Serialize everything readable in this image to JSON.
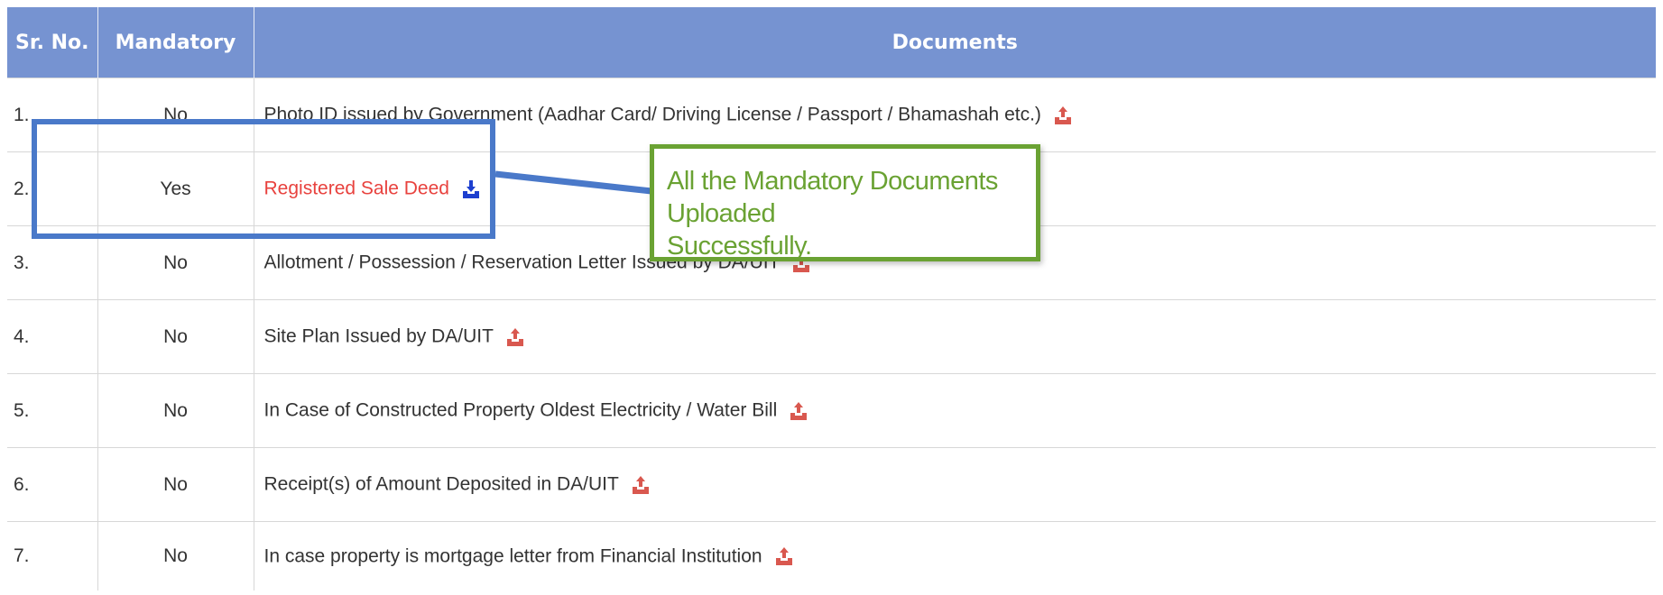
{
  "table": {
    "headers": {
      "sr_no": "Sr. No.",
      "mandatory": "Mandatory",
      "documents": "Documents"
    },
    "rows": [
      {
        "sr": "1.",
        "mandatory": "No",
        "document": "Photo ID issued by Government (Aadhar Card/ Driving License / Passport / Bhamashah etc.)",
        "icon": "upload-icon"
      },
      {
        "sr": "2.",
        "mandatory": "Yes",
        "document": "Registered Sale Deed",
        "icon": "download-icon"
      },
      {
        "sr": "3.",
        "mandatory": "No",
        "document": "Allotment / Possession / Reservation Letter Issued by DA/UIT",
        "icon": "upload-icon"
      },
      {
        "sr": "4.",
        "mandatory": "No",
        "document": "Site Plan Issued by DA/UIT",
        "icon": "upload-icon"
      },
      {
        "sr": "5.",
        "mandatory": "No",
        "document": "In Case of Constructed Property Oldest Electricity / Water Bill",
        "icon": "upload-icon"
      },
      {
        "sr": "6.",
        "mandatory": "No",
        "document": "Receipt(s) of Amount Deposited in DA/UIT",
        "icon": "upload-icon"
      },
      {
        "sr": "7.",
        "mandatory": "No",
        "document": "In case property is mortgage letter from Financial Institution",
        "icon": "upload-icon"
      }
    ]
  },
  "callout": {
    "line1": "All the Mandatory Documents Uploaded",
    "line2": "Successfully."
  },
  "colors": {
    "header_bg": "#7693d1",
    "mandatory_text": "#e8423e",
    "upload_icon": "#d9584f",
    "download_icon": "#1d3fcf",
    "highlight_border": "#4a79c9",
    "callout_border": "#6aa233"
  }
}
